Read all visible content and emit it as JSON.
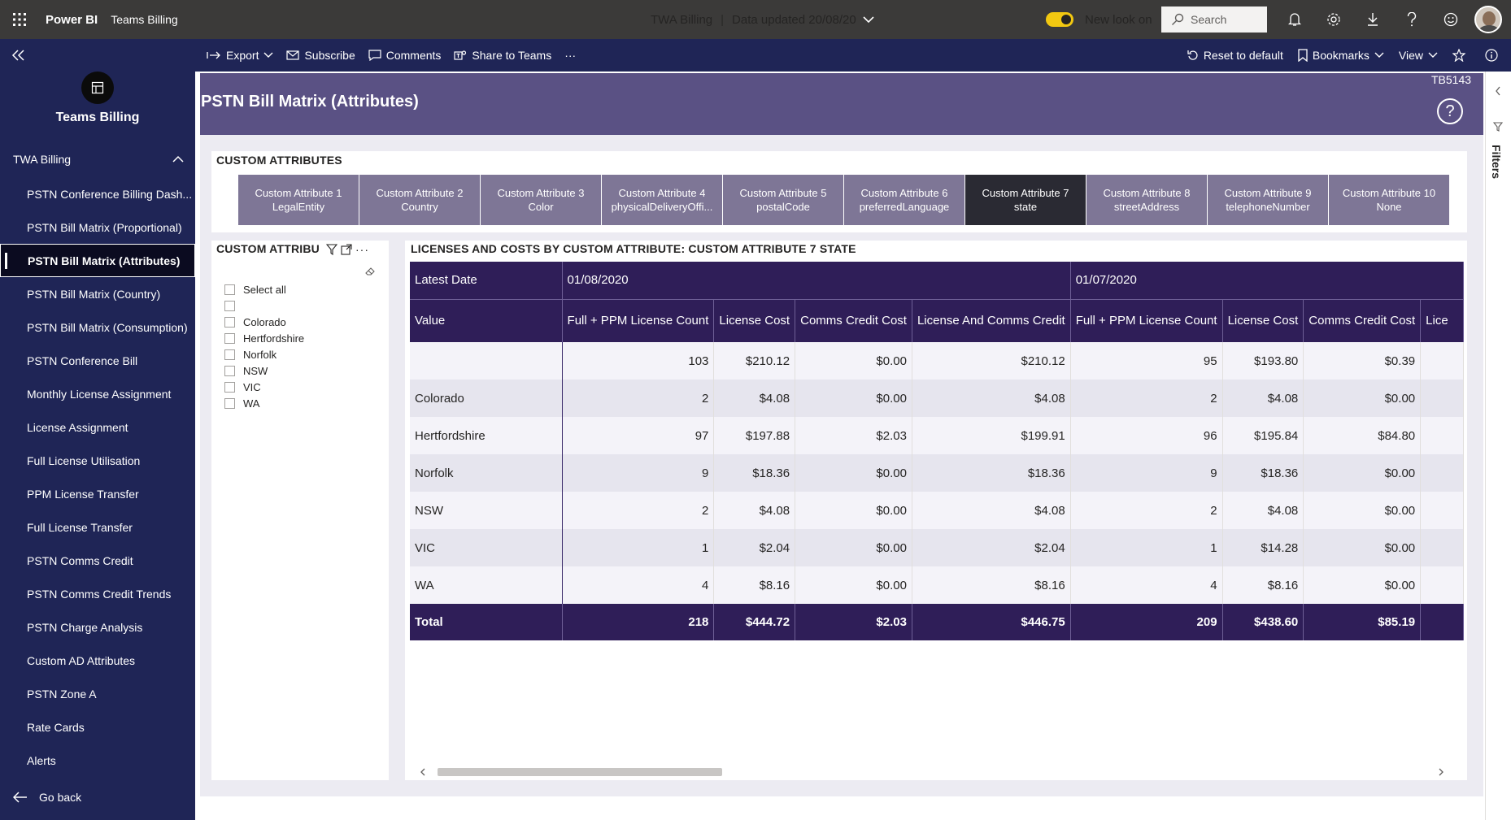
{
  "topbar": {
    "brand": "Power BI",
    "workspace": "Teams Billing",
    "report_name": "TWA Billing",
    "data_updated": "Data updated 20/08/20",
    "new_look": "New look on",
    "search_placeholder": "Search",
    "accent": "#f2c811"
  },
  "leftnav": {
    "workspace_name": "Teams Billing",
    "app_section": "TWA Billing",
    "items": [
      "PSTN Conference Billing Dash...",
      "PSTN Bill Matrix (Proportional)",
      "PSTN Bill Matrix (Attributes)",
      "PSTN Bill Matrix (Country)",
      "PSTN Bill Matrix (Consumption)",
      "PSTN Conference Bill",
      "Monthly License Assignment",
      "License Assignment",
      "Full License Utilisation",
      "PPM License Transfer",
      "Full License Transfer",
      "PSTN Comms Credit",
      "PSTN Comms Credit Trends",
      "PSTN Charge Analysis",
      "Custom AD Attributes",
      "PSTN Zone A",
      "Rate Cards",
      "Alerts"
    ],
    "active_index": 2,
    "go_back": "Go back"
  },
  "actionbar": {
    "export": "Export",
    "subscribe": "Subscribe",
    "comments": "Comments",
    "share": "Share to Teams",
    "more": "···",
    "reset": "Reset to default",
    "bookmarks": "Bookmarks",
    "view": "View"
  },
  "report": {
    "title": "PSTN Bill Matrix (Attributes)",
    "code": "TB5143",
    "help": "?",
    "header_color": "#5a5184"
  },
  "custom_attributes": {
    "title": "CUSTOM ATTRIBUTES",
    "buttons": [
      {
        "l1": "Custom Attribute 1",
        "l2": "LegalEntity"
      },
      {
        "l1": "Custom Attribute 2",
        "l2": "Country"
      },
      {
        "l1": "Custom Attribute 3",
        "l2": "Color"
      },
      {
        "l1": "Custom Attribute 4",
        "l2": "physicalDeliveryOffi..."
      },
      {
        "l1": "Custom Attribute 5",
        "l2": "postalCode"
      },
      {
        "l1": "Custom Attribute 6",
        "l2": "preferredLanguage"
      },
      {
        "l1": "Custom Attribute 7",
        "l2": "state"
      },
      {
        "l1": "Custom Attribute 8",
        "l2": "streetAddress"
      },
      {
        "l1": "Custom Attribute 9",
        "l2": "telephoneNumber"
      },
      {
        "l1": "Custom Attribute 10",
        "l2": "None"
      }
    ],
    "selected_index": 6
  },
  "slicer": {
    "title": "CUSTOM ATTRIBU",
    "items": [
      "Select all",
      "",
      "Colorado",
      "Hertfordshire",
      "Norfolk",
      "NSW",
      "VIC",
      "WA"
    ]
  },
  "matrix": {
    "title": "LICENSES AND COSTS BY CUSTOM ATTRIBUTE: CUSTOM ATTRIBUTE 7 STATE",
    "row_header_top": "Latest Date",
    "row_header": "Value",
    "periods": [
      "01/08/2020",
      "01/07/2020"
    ],
    "columns": [
      "Full + PPM License Count",
      "License Cost",
      "Comms Credit Cost",
      "License And Comms Credit",
      "Full + PPM License Count",
      "License Cost",
      "Comms Credit Cost",
      "Lice"
    ],
    "rows": [
      {
        "label": "",
        "values": [
          "103",
          "$210.12",
          "$0.00",
          "$210.12",
          "95",
          "$193.80",
          "$0.39",
          ""
        ]
      },
      {
        "label": "Colorado",
        "values": [
          "2",
          "$4.08",
          "$0.00",
          "$4.08",
          "2",
          "$4.08",
          "$0.00",
          ""
        ]
      },
      {
        "label": "Hertfordshire",
        "values": [
          "97",
          "$197.88",
          "$2.03",
          "$199.91",
          "96",
          "$195.84",
          "$84.80",
          ""
        ]
      },
      {
        "label": "Norfolk",
        "values": [
          "9",
          "$18.36",
          "$0.00",
          "$18.36",
          "9",
          "$18.36",
          "$0.00",
          ""
        ]
      },
      {
        "label": "NSW",
        "values": [
          "2",
          "$4.08",
          "$0.00",
          "$4.08",
          "2",
          "$4.08",
          "$0.00",
          ""
        ]
      },
      {
        "label": "VIC",
        "values": [
          "1",
          "$2.04",
          "$0.00",
          "$2.04",
          "1",
          "$14.28",
          "$0.00",
          ""
        ]
      },
      {
        "label": "WA",
        "values": [
          "4",
          "$8.16",
          "$0.00",
          "$8.16",
          "4",
          "$8.16",
          "$0.00",
          ""
        ]
      }
    ],
    "total": {
      "label": "Total",
      "values": [
        "218",
        "$444.72",
        "$2.03",
        "$446.75",
        "209",
        "$438.60",
        "$85.19",
        ""
      ]
    },
    "header_color": "#2f1e58"
  },
  "filter_pane": {
    "label": "Filters"
  }
}
